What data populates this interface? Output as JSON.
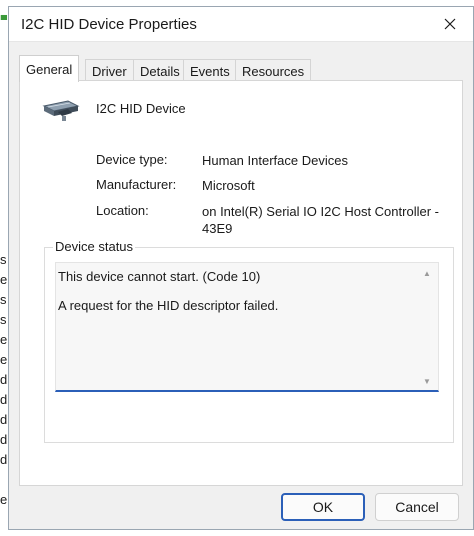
{
  "window": {
    "title": "I2C HID Device Properties"
  },
  "tabs": [
    {
      "label": "General"
    },
    {
      "label": "Driver"
    },
    {
      "label": "Details"
    },
    {
      "label": "Events"
    },
    {
      "label": "Resources"
    }
  ],
  "general": {
    "device_name": "I2C HID Device",
    "properties": {
      "device_type": {
        "label": "Device type:",
        "value": "Human Interface Devices"
      },
      "manufacturer": {
        "label": "Manufacturer:",
        "value": "Microsoft"
      },
      "location": {
        "label": "Location:",
        "value": "on Intel(R) Serial IO I2C Host Controller - 43E9"
      }
    },
    "device_status": {
      "label": "Device status",
      "line1": "This device cannot start. (Code 10)",
      "line2": "A request for the HID descriptor failed."
    }
  },
  "buttons": {
    "ok": "OK",
    "cancel": "Cancel"
  },
  "background_letters": [
    "s",
    "e",
    "s",
    "s",
    "e",
    "e",
    "d",
    "d",
    "d",
    "d",
    "d",
    "e"
  ],
  "colors": {
    "accent": "#2b5fb8",
    "dialog_bg": "#f0f0f0",
    "panel_bg": "#ffffff"
  }
}
